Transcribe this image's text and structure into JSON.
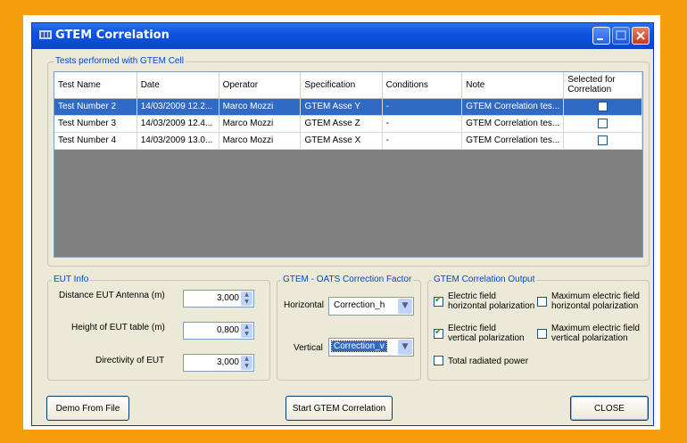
{
  "window": {
    "title": "GTEM Correlation"
  },
  "tests_group": {
    "legend": "Tests performed with GTEM Cell",
    "columns": [
      "Test Name",
      "Date",
      "Operator",
      "Specification",
      "Conditions",
      "Note",
      "Selected for Correlation"
    ],
    "rows": [
      {
        "test_name": "Test Number 2",
        "date": "14/03/2009 12.2...",
        "operator": "Marco Mozzi",
        "specification": "GTEM Asse Y",
        "conditions": "-",
        "note": "GTEM Correlation tes...",
        "selected": false
      },
      {
        "test_name": "Test Number 3",
        "date": "14/03/2009 12.4...",
        "operator": "Marco Mozzi",
        "specification": "GTEM Asse Z",
        "conditions": "-",
        "note": "GTEM Correlation tes...",
        "selected": false
      },
      {
        "test_name": "Test Number 4",
        "date": "14/03/2009 13.0...",
        "operator": "Marco Mozzi",
        "specification": "GTEM Asse X",
        "conditions": "-",
        "note": "GTEM Correlation tes...",
        "selected": false
      }
    ]
  },
  "eut_info": {
    "legend": "EUT Info",
    "distance_label": "Distance EUT Antenna (m)",
    "distance_value": "3,000",
    "height_label": "Height of EUT table (m)",
    "height_value": "0,800",
    "directivity_label": "Directivity of EUT",
    "directivity_value": "3,000"
  },
  "correction": {
    "legend": "GTEM - OATS Correction  Factor",
    "horizontal_label": "Horizontal",
    "horizontal_value": "Correction_h",
    "vertical_label": "Vertical",
    "vertical_value": "Correction_v"
  },
  "output": {
    "legend": "GTEM Correlation Output",
    "efh_line1": "Electric field",
    "efh_line2": "horizontal polarization",
    "efh_checked": true,
    "efv_line1": "Electric field",
    "efv_line2": "vertical polarization",
    "efv_checked": true,
    "trp": "Total radiated power",
    "trp_checked": false,
    "maxh_line1": "Maximum electric field",
    "maxh_line2": "horizontal polarization",
    "maxh_checked": false,
    "maxv_line1": "Maximum electric field",
    "maxv_line2": "vertical polarization",
    "maxv_checked": false
  },
  "buttons": {
    "demo": "Demo From File",
    "start": "Start GTEM Correlation",
    "close": "CLOSE"
  },
  "colors": {
    "background": "#f59d0c",
    "titlebar": "#0a4bd5",
    "selection": "#316ac5",
    "legend_text": "#0046d5"
  }
}
